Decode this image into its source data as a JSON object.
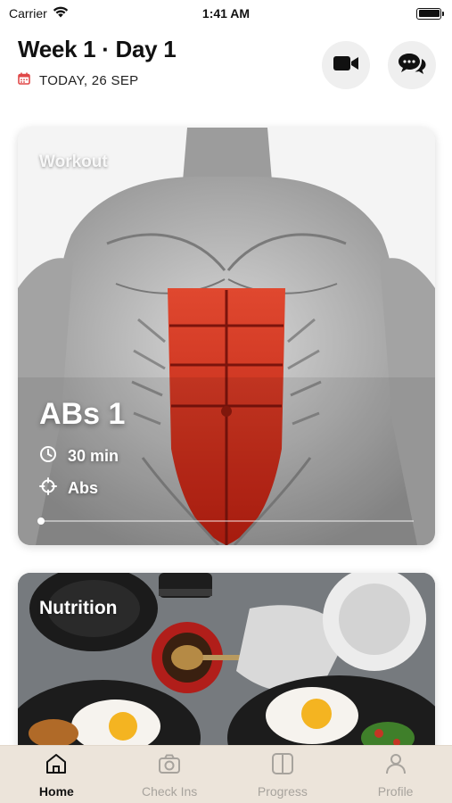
{
  "status_bar": {
    "carrier": "Carrier",
    "time": "1:41 AM"
  },
  "header": {
    "title": "Week 1 · Day 1",
    "date": "TODAY, 26 SEP"
  },
  "workout_card": {
    "tag": "Workout",
    "name": "ABs 1",
    "duration": "30 min",
    "target": "Abs"
  },
  "nutrition_card": {
    "tag": "Nutrition"
  },
  "tabs": [
    {
      "label": "Home",
      "icon": "home-icon",
      "active": true
    },
    {
      "label": "Check Ins",
      "icon": "camera-icon",
      "active": false
    },
    {
      "label": "Progress",
      "icon": "progress-icon",
      "active": false
    },
    {
      "label": "Profile",
      "icon": "person-icon",
      "active": false
    }
  ],
  "colors": {
    "tab_bar_bg": "#ece4da",
    "active_tab": "#111111",
    "inactive_tab": "#a7a39d",
    "calendar_icon": "#e04848",
    "muscle_highlight": "#d2301d"
  }
}
